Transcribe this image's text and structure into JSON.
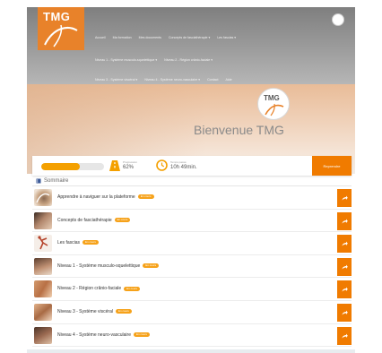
{
  "header": {
    "logo_text": "TMG",
    "nav_row1": [
      "Accueil",
      "Ma formation",
      "Mes documents",
      "Concepts de fasciathérapie ▾",
      "Les fascias ▾"
    ],
    "nav_row2": [
      "Niveau 1 - Système musculo-squelettique ▾",
      "Niveau 2 - Région crânio-faciale ▾"
    ],
    "nav_row3": [
      "Niveau 3 - Système viscéral ▾",
      "Niveau 4 - Système neuro-vasculaire ▾",
      "Contact",
      "Aide"
    ]
  },
  "banner": {
    "logo_text": "TMG",
    "welcome": "Bienvenue TMG"
  },
  "stats": {
    "progress_value": 0.62,
    "progress_caption": "Progression",
    "progress_percent": "62%",
    "time_caption": "Temps passé",
    "time_value": "10h 49min.",
    "resume_label": "Reprendre"
  },
  "summary": {
    "title": "Sommaire"
  },
  "modules": [
    {
      "title": "Apprendre à naviguer sur la plateforme",
      "badge": "En cours"
    },
    {
      "title": "Concepts de fasciathérapie",
      "badge": "En cours"
    },
    {
      "title": "Les fascias",
      "badge": "En cours"
    },
    {
      "title": "Niveau 1 - Système musculo-squelettique",
      "badge": "En cours"
    },
    {
      "title": "Niveau 2 - Région crânio-faciale",
      "badge": "En cours"
    },
    {
      "title": "Niveau 3 - Système viscéral",
      "badge": "En cours"
    },
    {
      "title": "Niveau 4 - Système neuro-vasculaire",
      "badge": "En cours"
    }
  ],
  "colors": {
    "accent": "#f07b00",
    "badge": "#f6a21a",
    "progress": "#f4a000"
  }
}
